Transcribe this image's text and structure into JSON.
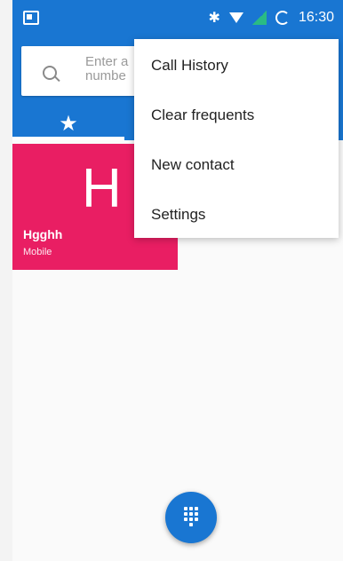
{
  "status_bar": {
    "time": "16:30",
    "icons": [
      "image-icon",
      "bluetooth-icon",
      "wifi-icon",
      "signal-icon",
      "loading-icon"
    ]
  },
  "search": {
    "placeholder": "Enter a numbe"
  },
  "tabs": [
    {
      "name": "favorites",
      "icon": "star-icon",
      "label": "★",
      "active": true
    }
  ],
  "contact": {
    "initial": "H",
    "name": "Hgghh",
    "type": "Mobile",
    "tile_color": "#e91e63"
  },
  "menu": {
    "items": [
      {
        "label": "Call History"
      },
      {
        "label": "Clear frequents"
      },
      {
        "label": "New contact"
      },
      {
        "label": "Settings"
      }
    ]
  },
  "fab": {
    "icon": "dialpad-icon"
  },
  "colors": {
    "primary": "#1976d2",
    "background": "#fafafa",
    "accent": "#e91e63"
  }
}
